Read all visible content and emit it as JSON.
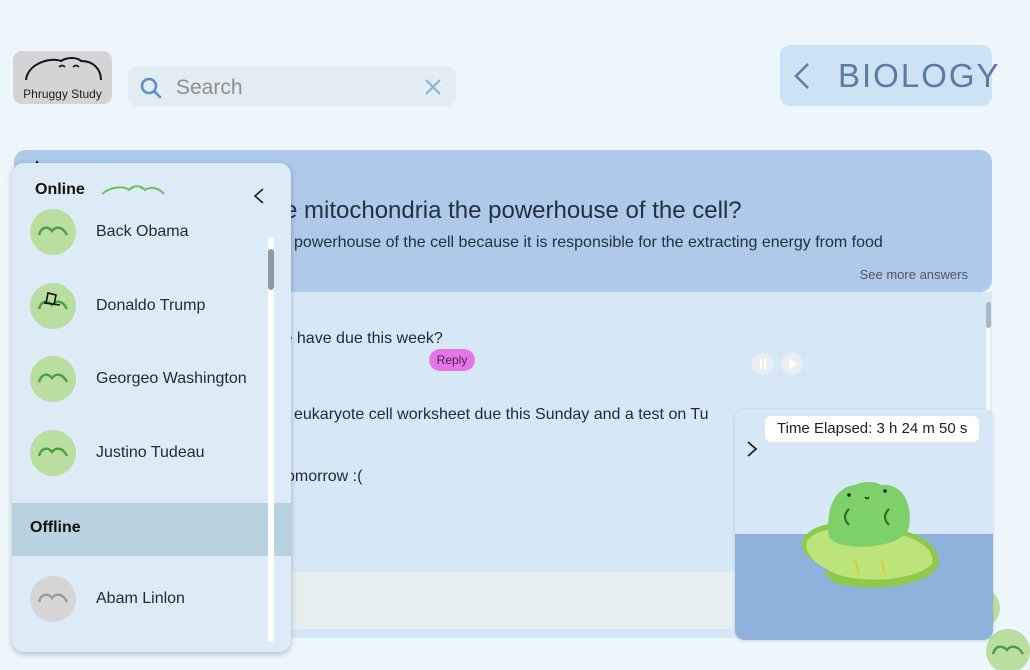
{
  "app": {
    "name": "Phruggy Study"
  },
  "search": {
    "placeholder": "Search",
    "value": ""
  },
  "subject": {
    "title": "BIOLOGY"
  },
  "question": {
    "title": "e mitochondria the powerhouse of the cell?",
    "answer": "powerhouse of the cell because it is responsible for the extracting energy from food",
    "see_more": "See more answers"
  },
  "chat": {
    "messages": [
      "we have due this week?",
      "eukaryote cell worksheet due this Sunday and a test on Tu",
      "omorrow :("
    ],
    "reply_label": "Reply"
  },
  "sidebar": {
    "online_label": "Online",
    "offline_label": "Offline",
    "online_users": [
      "Back Obama",
      "Donaldo Trump",
      "Georgeo Washington",
      "Justino Tudeau"
    ],
    "offline_users": [
      "Abam Linlon"
    ]
  },
  "timer": {
    "label": "Time Elapsed: 3 h 24 m 50 s"
  },
  "colors": {
    "background": "#eef6fd",
    "question_card": "#aec9ea",
    "chat_panel": "#d6e8f5",
    "reply_button": "#e775ea",
    "online_avatar": "#b9de9f",
    "offline_avatar": "#d6d6d6",
    "subject_text": "#5a7ba3"
  }
}
